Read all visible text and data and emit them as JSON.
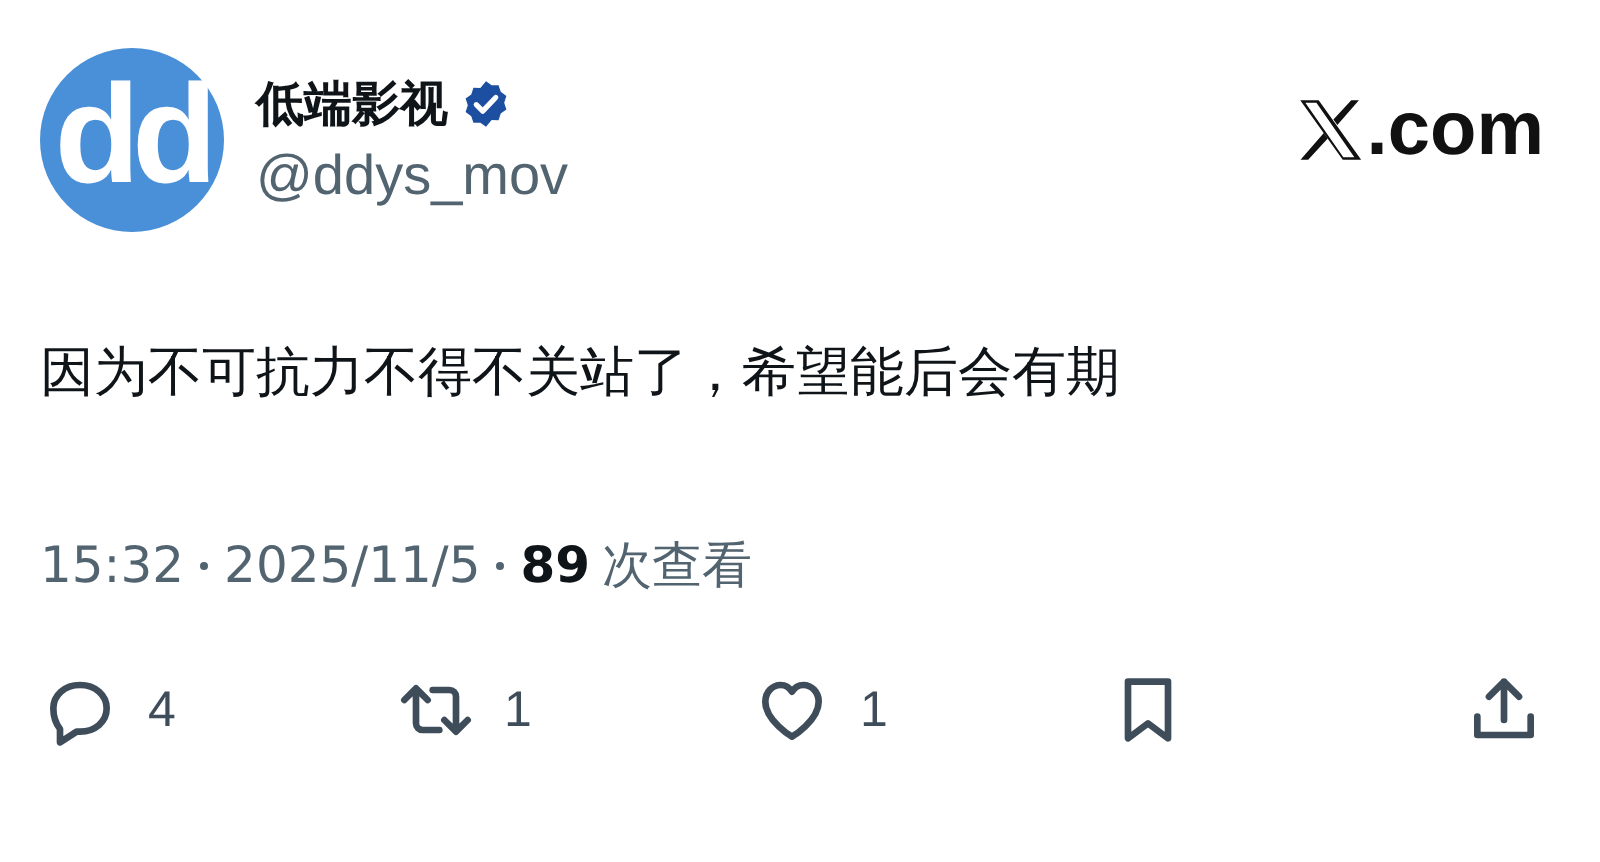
{
  "author": {
    "avatar_text": "dd",
    "name": "低端影视",
    "verified": true,
    "handle": "@ddys_mov"
  },
  "brand": {
    "suffix": ".com"
  },
  "tweet": {
    "text": "因为不可抗力不得不关站了，希望能后会有期"
  },
  "meta": {
    "time": "15:32",
    "date": "2025/11/5",
    "views": "89",
    "views_label": "次查看"
  },
  "actions": [
    {
      "kind": "reply",
      "count": "4"
    },
    {
      "kind": "repost",
      "count": "1"
    },
    {
      "kind": "like",
      "count": "1"
    },
    {
      "kind": "bookmark"
    },
    {
      "kind": "share"
    }
  ]
}
